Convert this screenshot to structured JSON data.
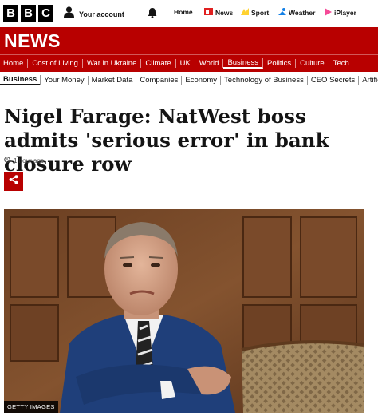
{
  "brand": {
    "logo_letters": [
      "B",
      "B",
      "C"
    ]
  },
  "account": {
    "label": "Your account",
    "icon": "user-icon"
  },
  "notifications": {
    "icon": "bell-icon"
  },
  "top_nav": [
    {
      "label": "Home",
      "icon": ""
    },
    {
      "label": "News",
      "icon": "news-icon",
      "icon_color": "#e02020"
    },
    {
      "label": "Sport",
      "icon": "sport-icon",
      "icon_color": "#ffd230"
    },
    {
      "label": "Weather",
      "icon": "weather-icon",
      "icon_color": "#1380e6"
    },
    {
      "label": "iPlayer",
      "icon": "iplayer-icon",
      "icon_color": "#f54997"
    }
  ],
  "section": {
    "title": "NEWS",
    "accent": "#b80000"
  },
  "main_nav": [
    {
      "label": "Home"
    },
    {
      "label": "Cost of Living"
    },
    {
      "label": "War in Ukraine"
    },
    {
      "label": "Climate"
    },
    {
      "label": "UK"
    },
    {
      "label": "World"
    },
    {
      "label": "Business",
      "active": true
    },
    {
      "label": "Politics"
    },
    {
      "label": "Culture"
    },
    {
      "label": "Tech"
    }
  ],
  "sub_nav": [
    {
      "label": "Business",
      "active": true
    },
    {
      "label": "Your Money"
    },
    {
      "label": "Market Data"
    },
    {
      "label": "Companies"
    },
    {
      "label": "Economy"
    },
    {
      "label": "Technology of Business"
    },
    {
      "label": "CEO Secrets"
    },
    {
      "label": "Artificial"
    }
  ],
  "article": {
    "headline": "Nigel Farage: NatWest boss admits 'serious error' in bank closure row",
    "timestamp": "1 hour ago",
    "share_icon": "share-icon",
    "image_credit": "GETTY IMAGES"
  }
}
